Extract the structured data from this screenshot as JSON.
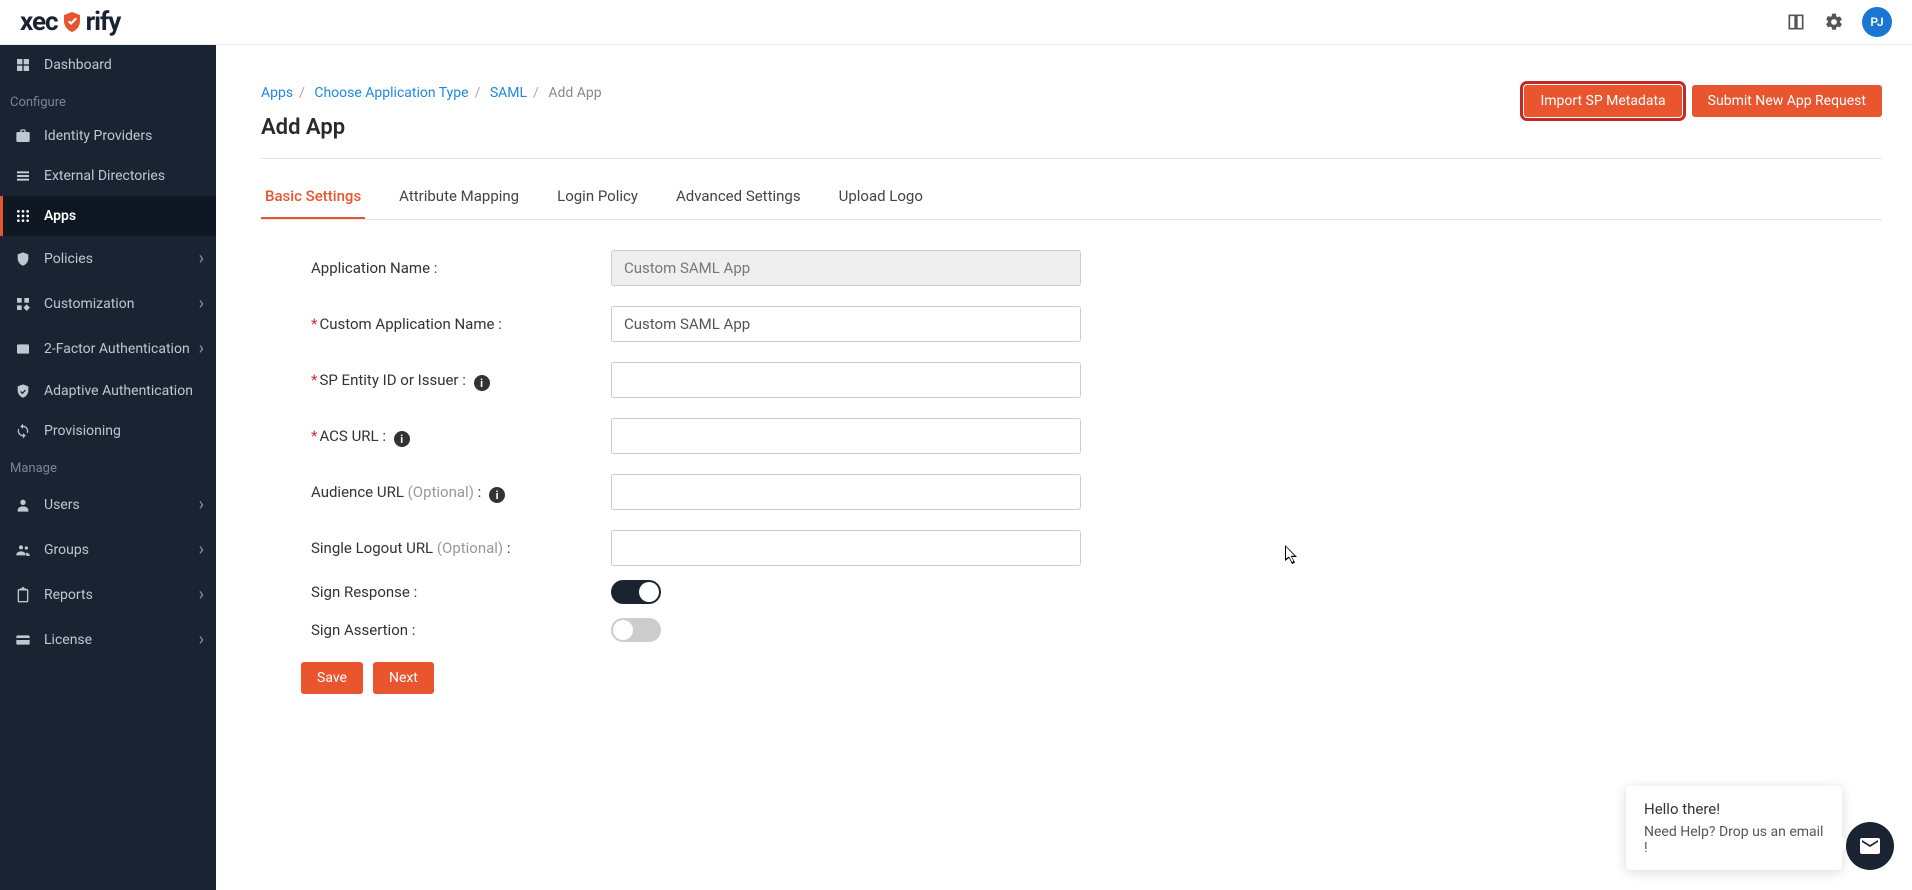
{
  "brand": {
    "name_left": "xec",
    "name_right": "rify"
  },
  "avatar": "PJ",
  "sidebar": {
    "section_configure": "Configure",
    "section_manage": "Manage",
    "items": {
      "dashboard": "Dashboard",
      "idp": "Identity Providers",
      "extdir": "External Directories",
      "apps": "Apps",
      "policies": "Policies",
      "customization": "Customization",
      "twofa": "2-Factor Authentication",
      "adaptive": "Adaptive Authentication",
      "provisioning": "Provisioning",
      "users": "Users",
      "groups": "Groups",
      "reports": "Reports",
      "license": "License"
    }
  },
  "breadcrumb": {
    "apps": "Apps",
    "choose": "Choose Application Type",
    "saml": "SAML",
    "add": "Add App"
  },
  "page_title": "Add App",
  "actions": {
    "import": "Import SP Metadata",
    "submit": "Submit New App Request"
  },
  "tabs": {
    "basic": "Basic Settings",
    "attr": "Attribute Mapping",
    "login": "Login Policy",
    "advanced": "Advanced Settings",
    "upload": "Upload Logo"
  },
  "form": {
    "app_name_label": "Application Name :",
    "app_name_value": "Custom SAML App",
    "custom_name_label": "Custom Application Name :",
    "custom_name_value": "Custom SAML App",
    "entity_label": "SP Entity ID or Issuer :",
    "entity_value": "",
    "acs_label": "ACS URL :",
    "acs_value": "",
    "audience_label": "Audience URL ",
    "optional": "(Optional)",
    "audience_value": "",
    "slo_label": "Single Logout URL ",
    "slo_value": "",
    "sign_response_label": "Sign Response :",
    "sign_assertion_label": "Sign Assertion :",
    "save": "Save",
    "next": "Next",
    "colon": " :"
  },
  "help": {
    "hello": "Hello there!",
    "need": "Need Help? Drop us an email !"
  }
}
